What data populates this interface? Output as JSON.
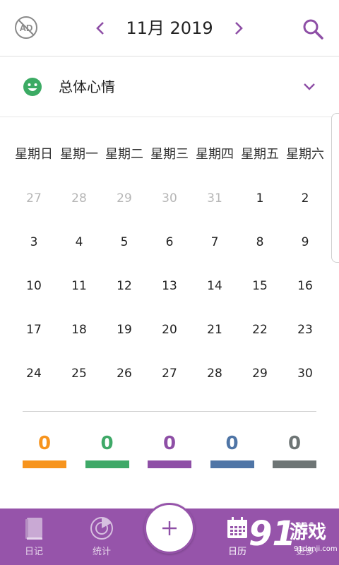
{
  "header": {
    "title": "11月 2019",
    "icons": {
      "no_ads": "no-ads-icon",
      "prev": "chevron-left-icon",
      "next": "chevron-right-icon",
      "search": "search-icon"
    }
  },
  "mood_filter": {
    "label": "总体心情",
    "icon": "smiley-face-icon",
    "icon_color": "#3cab64"
  },
  "calendar": {
    "weekdays": [
      "星期日",
      "星期一",
      "星期二",
      "星期三",
      "星期四",
      "星期五",
      "星期六"
    ],
    "weeks": [
      [
        {
          "d": "27",
          "other": true
        },
        {
          "d": "28",
          "other": true
        },
        {
          "d": "29",
          "other": true
        },
        {
          "d": "30",
          "other": true
        },
        {
          "d": "31",
          "other": true
        },
        {
          "d": "1",
          "other": false
        },
        {
          "d": "2",
          "other": false
        }
      ],
      [
        {
          "d": "3",
          "other": false
        },
        {
          "d": "4",
          "other": false
        },
        {
          "d": "5",
          "other": false
        },
        {
          "d": "6",
          "other": false
        },
        {
          "d": "7",
          "other": false
        },
        {
          "d": "8",
          "other": false
        },
        {
          "d": "9",
          "other": false
        }
      ],
      [
        {
          "d": "10",
          "other": false
        },
        {
          "d": "11",
          "other": false
        },
        {
          "d": "12",
          "other": false
        },
        {
          "d": "13",
          "other": false
        },
        {
          "d": "14",
          "other": false
        },
        {
          "d": "15",
          "other": false
        },
        {
          "d": "16",
          "other": false
        }
      ],
      [
        {
          "d": "17",
          "other": false
        },
        {
          "d": "18",
          "other": false
        },
        {
          "d": "19",
          "other": false
        },
        {
          "d": "20",
          "other": false
        },
        {
          "d": "21",
          "other": false
        },
        {
          "d": "22",
          "other": false
        },
        {
          "d": "23",
          "other": false
        }
      ],
      [
        {
          "d": "24",
          "other": false
        },
        {
          "d": "25",
          "other": false
        },
        {
          "d": "26",
          "other": false
        },
        {
          "d": "27",
          "other": false
        },
        {
          "d": "28",
          "other": false
        },
        {
          "d": "29",
          "other": false
        },
        {
          "d": "30",
          "other": false
        }
      ]
    ]
  },
  "mood_stats": [
    {
      "count": "0",
      "color": "#f7941d"
    },
    {
      "count": "0",
      "color": "#3fa968"
    },
    {
      "count": "0",
      "color": "#8e4fa6"
    },
    {
      "count": "0",
      "color": "#4f75a6"
    },
    {
      "count": "0",
      "color": "#6e7575"
    }
  ],
  "bottom_nav": {
    "bar_color": "#9654aa",
    "tabs": [
      {
        "label": "日记",
        "icon": "book-icon"
      },
      {
        "label": "统计",
        "icon": "chart-disc-icon"
      },
      {
        "label": "日历",
        "icon": "calendar-icon"
      },
      {
        "label": "更多",
        "icon": "more-dots-icon"
      }
    ],
    "fab_icon": "plus-icon"
  },
  "watermark": {
    "logo": "91",
    "text": "游戏",
    "sub": "91danji.com"
  }
}
